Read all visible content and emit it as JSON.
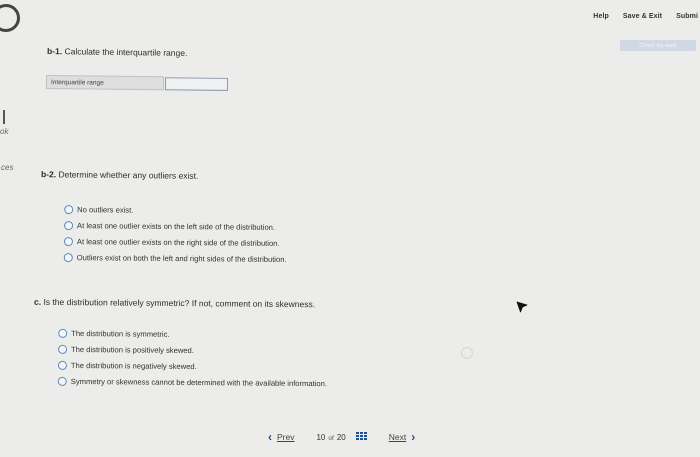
{
  "header": {
    "help_label": "Help",
    "save_exit_label": "Save & Exit",
    "submit_label": "Submi",
    "check_work_label": "Check my work"
  },
  "gutter": {
    "text_1": "ok",
    "text_2": "ces"
  },
  "question_b1": {
    "number": "b-1.",
    "prompt": "Calculate the interquartile range.",
    "field_label": "Interquartile range",
    "field_value": ""
  },
  "question_b2": {
    "number": "b-2.",
    "prompt": "Determine whether any outliers exist.",
    "options": [
      "No outliers exist.",
      "At least one outlier exists on the left side of the distribution.",
      "At least one outlier exists on the right side of the distribution.",
      "Outliers exist on both the left and right sides of the distribution."
    ]
  },
  "question_c": {
    "number": "c.",
    "prompt": "Is the distribution relatively symmetric? If not, comment on its skewness.",
    "options": [
      "The distribution is symmetric.",
      "The distribution is positively skewed.",
      "The distribution is negatively skewed.",
      "Symmetry or skewness cannot be determined with the available information."
    ]
  },
  "pagination": {
    "prev_label": "Prev",
    "current": "10",
    "of_label": "of",
    "total": "20",
    "next_label": "Next"
  },
  "colors": {
    "accent": "#1e4f93",
    "radio_border": "#5a8bbd",
    "background": "#ececea"
  },
  "icons": {
    "grid": "grid-icon",
    "prev": "chevron-left-icon",
    "next": "chevron-right-icon"
  }
}
